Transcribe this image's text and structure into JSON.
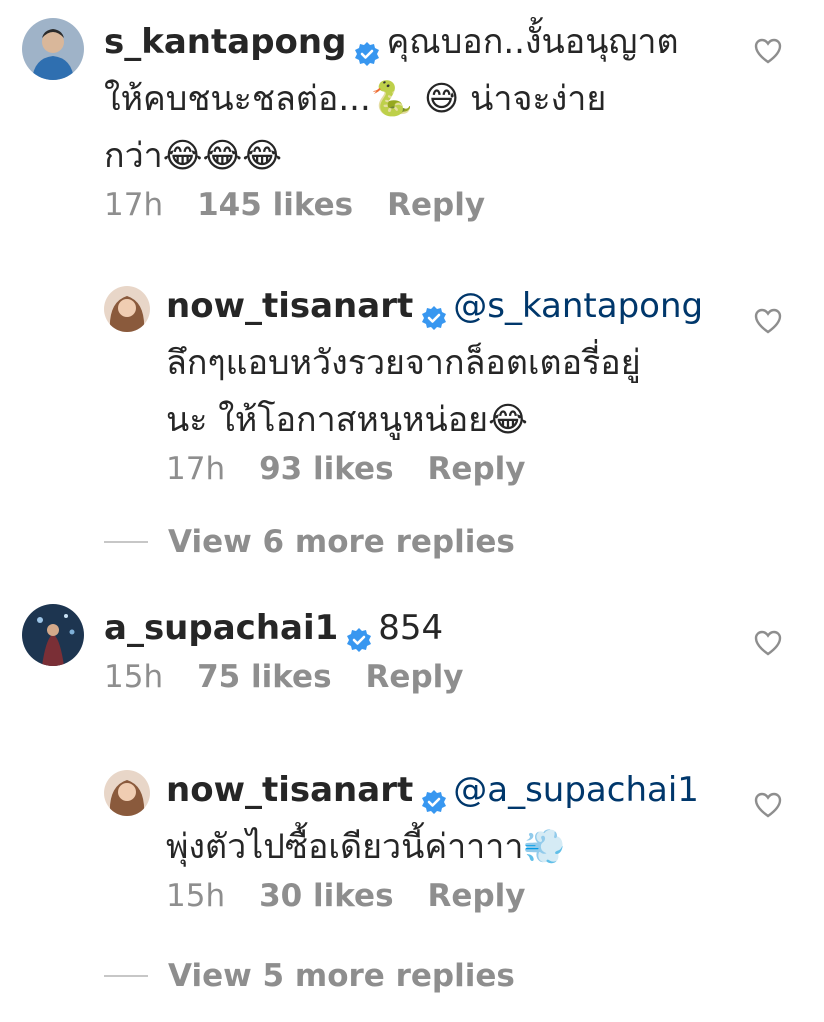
{
  "comments": [
    {
      "username": "s_kantapong",
      "text_lines": [
        "คุณบอก..งั้นอนุญาต",
        "ให้คบชนะชลต่อ...🐍 😅 น่าจะง่าย",
        "กว่า😂😂😂"
      ],
      "time": "17h",
      "likes": "145 likes",
      "reply": "Reply",
      "verified": true,
      "like_icon": "heart-outline-icon"
    },
    {
      "username": "now_tisanart",
      "mention": "@s_kantapong",
      "text_lines": [
        "ลึกๆแอบหวังรวยจากล็อตเตอรี่อยู่",
        "นะ ให้โอกาสหนูหน่อย😂"
      ],
      "time": "17h",
      "likes": "93 likes",
      "reply": "Reply",
      "verified": true,
      "like_icon": "heart-outline-icon"
    },
    {
      "username": "a_supachai1",
      "text": "854",
      "time": "15h",
      "likes": "75 likes",
      "reply": "Reply",
      "verified": true,
      "like_icon": "heart-outline-icon"
    },
    {
      "username": "now_tisanart",
      "mention": "@a_supachai1",
      "text_lines": [
        "พุ่งตัวไปซื้อเดียวนี้ค่าาาา💨"
      ],
      "time": "15h",
      "likes": "30 likes",
      "reply": "Reply",
      "verified": true,
      "like_icon": "heart-outline-icon"
    }
  ],
  "view_more": [
    "View 6 more replies",
    "View 5 more replies"
  ],
  "colors": {
    "text": "#262626",
    "muted": "#8e8e8e",
    "mention": "#00376b",
    "verified": "#3897f0"
  }
}
